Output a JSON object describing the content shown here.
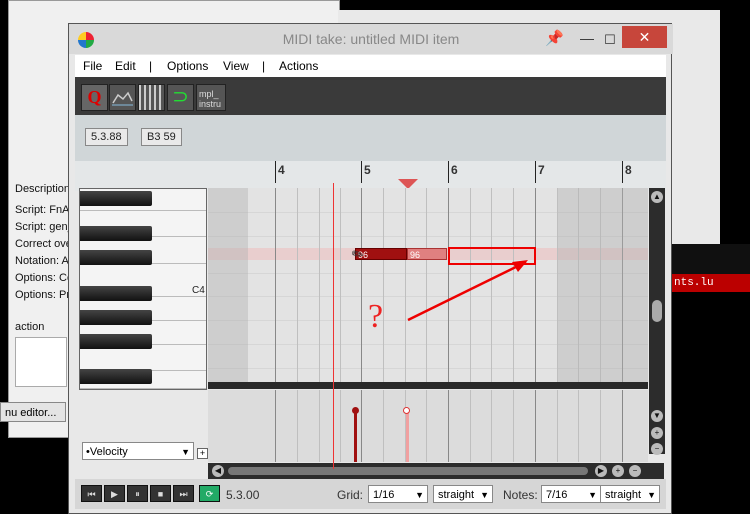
{
  "background": {
    "rows": [
      "Description",
      "Script: FnA_",
      "Script: gen_",
      "Correct ove",
      "Notation: A",
      "Options: Co",
      "Options: Pr"
    ],
    "section_label": "action",
    "button_label": "nu editor...",
    "red_text": "nts.lu"
  },
  "window": {
    "title": "MIDI take: untitled MIDI item",
    "close": "✕",
    "minimize": "—",
    "maximize": "☐",
    "pin": "📌"
  },
  "menu": {
    "file": "File",
    "edit": "Edit",
    "sep1": "|",
    "options": "Options",
    "view": "View",
    "sep2": "|",
    "actions": "Actions"
  },
  "toolbar": {
    "q_label": "Q",
    "mpl_label_1": "mpl_",
    "mpl_label_2": "instru"
  },
  "info": {
    "position": "5.3.88",
    "pitch": "B3  59"
  },
  "ruler": {
    "bars": [
      "4",
      "5",
      "6",
      "7",
      "8"
    ]
  },
  "piano": {
    "c4_label": "C4"
  },
  "notes": [
    {
      "velocity": "96"
    },
    {
      "velocity": "96"
    }
  ],
  "annotation": {
    "question": "?"
  },
  "lane": {
    "selected": "•Velocity",
    "add": "+"
  },
  "transport": {
    "position": "5.3.00",
    "grid_label": "Grid:",
    "grid_value": "1/16",
    "grid_type": "straight",
    "notes_label": "Notes:",
    "notes_value": "7/16",
    "notes_type": "straight"
  },
  "colors": {
    "note_selected": "#a01010",
    "note_light": "#e08080",
    "annotation": "#e00000",
    "close_button": "#c7463b"
  }
}
